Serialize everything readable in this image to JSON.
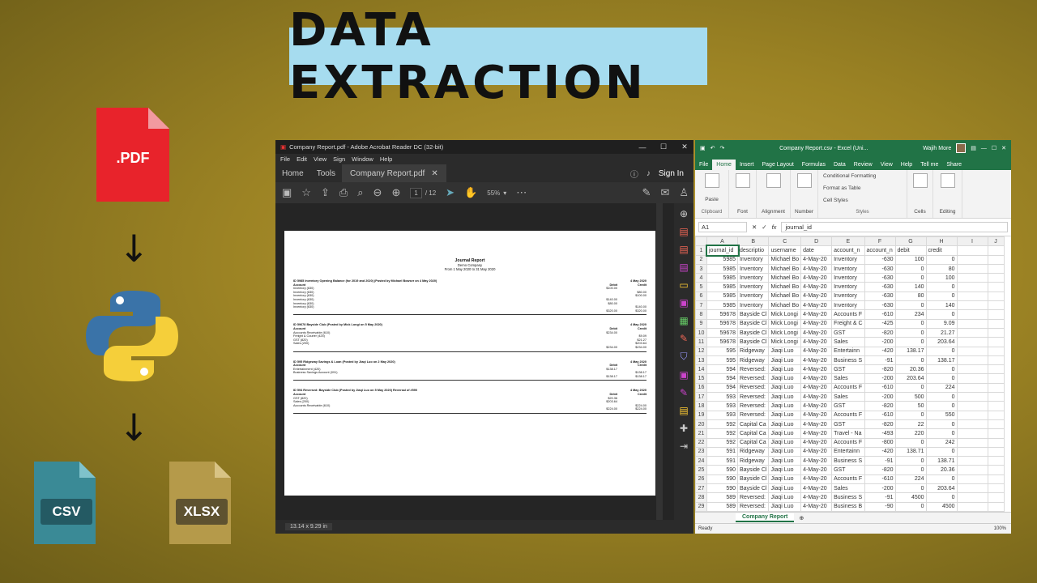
{
  "banner": {
    "title": "DATA EXTRACTION"
  },
  "left_icons": {
    "pdf_label": ".PDF",
    "csv_label": "CSV",
    "xlsx_label": "XLSX",
    "arrow": "↓"
  },
  "acrobat": {
    "title": "Company Report.pdf - Adobe Acrobat Reader DC (32-bit)",
    "menu": [
      "File",
      "Edit",
      "View",
      "Sign",
      "Window",
      "Help"
    ],
    "tabs": {
      "home": "Home",
      "tools": "Tools",
      "doc": "Company Report.pdf"
    },
    "sign_in": "Sign In",
    "page_current": "1",
    "page_total": "/ 12",
    "zoom": "55%",
    "page_size": "13.14 x 9.29 in",
    "report": {
      "title": "Journal Report",
      "company": "Demo Company",
      "period": "From 1 May 2020 to 31 May 2020",
      "entries": [
        {
          "header": "ID 5985 Inventory Opening Balance (for 2019 and 2020) (Posted by Michael Bowser on 4 May 2020)",
          "date": "4 May 2020",
          "rows": [
            [
              "Account",
              "Debit",
              "Credit"
            ],
            [
              "Inventory (630)",
              "$100.00",
              ""
            ],
            [
              "Inventory (630)",
              "",
              "$80.00"
            ],
            [
              "Inventory (630)",
              "",
              "$100.00"
            ],
            [
              "Inventory (630)",
              "$140.00",
              ""
            ],
            [
              "Inventory (630)",
              "$80.00",
              ""
            ],
            [
              "Inventory (630)",
              "",
              "$140.00"
            ],
            [
              "",
              "$320.00",
              "$320.00"
            ]
          ]
        },
        {
          "header": "ID 59678 Bayside Club (Posted by Mick Longi on 5 May 2020)",
          "date": "4 May 2020",
          "rows": [
            [
              "Account",
              "Debit",
              "Credit"
            ],
            [
              "Accounts Receivable (610)",
              "$234.00",
              ""
            ],
            [
              "Freight & Courier (425)",
              "",
              "$9.09"
            ],
            [
              "GST (820)",
              "",
              "$21.27"
            ],
            [
              "Sales (200)",
              "",
              "$203.64"
            ],
            [
              "",
              "$234.00",
              "$234.00"
            ]
          ]
        },
        {
          "header": "ID 595 Ridgeway Savings & Loan (Posted by Jiaqi Luo on 2 May 2020)",
          "date": "4 May 2020",
          "rows": [
            [
              "Account",
              "Debit",
              "Credit"
            ],
            [
              "Entertainment (420)",
              "$138.17",
              ""
            ],
            [
              "Business Savings Account (091)",
              "",
              "$138.17"
            ],
            [
              "",
              "$138.17",
              "$138.17"
            ]
          ]
        },
        {
          "header": "ID 594 Reversed: Bayside Club (Posted by Jiaqi Luo on 5 May 2020) Reversal of #590",
          "date": "4 May 2020",
          "rows": [
            [
              "Account",
              "Debit",
              "Credit"
            ],
            [
              "GST (820)",
              "$20.36",
              ""
            ],
            [
              "Sales (200)",
              "$203.64",
              ""
            ],
            [
              "Accounts Receivable (610)",
              "",
              "$224.00"
            ],
            [
              "",
              "$224.00",
              "$224.00"
            ]
          ]
        }
      ]
    }
  },
  "excel": {
    "title": "Company Report.csv - Excel (Uni...",
    "user": "Wajih More",
    "tabs": [
      "File",
      "Home",
      "Insert",
      "Page Layout",
      "Formulas",
      "Data",
      "Review",
      "View",
      "Help",
      "Tell me",
      "Share"
    ],
    "ribbon": {
      "clipboard": "Clipboard",
      "paste": "Paste",
      "font": "Font",
      "alignment": "Alignment",
      "number": "Number",
      "conditional": "Conditional Formatting",
      "format_table": "Format as Table",
      "cell_styles": "Cell Styles",
      "styles": "Styles",
      "cells": "Cells",
      "editing": "Editing"
    },
    "name_box": "A1",
    "formula": "journal_id",
    "columns": [
      "A",
      "B",
      "C",
      "D",
      "E",
      "F",
      "G",
      "H",
      "I",
      "J"
    ],
    "rows": [
      [
        "journal_id",
        "descriptio",
        "username",
        "date",
        "account_n",
        "account_n",
        "debit",
        "credit"
      ],
      [
        "5985",
        "Inventory",
        "Michael Bo",
        "4-May-20",
        "Inventory",
        "-630",
        "100",
        "0"
      ],
      [
        "5985",
        "Inventory",
        "Michael Bo",
        "4-May-20",
        "Inventory",
        "-630",
        "0",
        "80"
      ],
      [
        "5985",
        "Inventory",
        "Michael Bo",
        "4-May-20",
        "Inventory",
        "-630",
        "0",
        "100"
      ],
      [
        "5985",
        "Inventory",
        "Michael Bo",
        "4-May-20",
        "Inventory",
        "-630",
        "140",
        "0"
      ],
      [
        "5985",
        "Inventory",
        "Michael Bo",
        "4-May-20",
        "Inventory",
        "-630",
        "80",
        "0"
      ],
      [
        "5985",
        "Inventory",
        "Michael Bo",
        "4-May-20",
        "Inventory",
        "-630",
        "0",
        "140"
      ],
      [
        "59678",
        "Bayside Cl",
        "Mick Longi",
        "4-May-20",
        "Accounts F",
        "-610",
        "234",
        "0"
      ],
      [
        "59678",
        "Bayside Cl",
        "Mick Longi",
        "4-May-20",
        "Freight & C",
        "-425",
        "0",
        "9.09"
      ],
      [
        "59678",
        "Bayside Cl",
        "Mick Longi",
        "4-May-20",
        "GST",
        "-820",
        "0",
        "21.27"
      ],
      [
        "59678",
        "Bayside Cl",
        "Mick Longi",
        "4-May-20",
        "Sales",
        "-200",
        "0",
        "203.64"
      ],
      [
        "595",
        "Ridgeway",
        "Jiaqi Luo",
        "4-May-20",
        "Entertainn",
        "-420",
        "138.17",
        "0"
      ],
      [
        "595",
        "Ridgeway",
        "Jiaqi Luo",
        "4-May-20",
        "Business S",
        "-91",
        "0",
        "138.17"
      ],
      [
        "594",
        "Reversed:",
        "Jiaqi Luo",
        "4-May-20",
        "GST",
        "-820",
        "20.36",
        "0"
      ],
      [
        "594",
        "Reversed:",
        "Jiaqi Luo",
        "4-May-20",
        "Sales",
        "-200",
        "203.64",
        "0"
      ],
      [
        "594",
        "Reversed:",
        "Jiaqi Luo",
        "4-May-20",
        "Accounts F",
        "-610",
        "0",
        "224"
      ],
      [
        "593",
        "Reversed:",
        "Jiaqi Luo",
        "4-May-20",
        "Sales",
        "-200",
        "500",
        "0"
      ],
      [
        "593",
        "Reversed:",
        "Jiaqi Luo",
        "4-May-20",
        "GST",
        "-820",
        "50",
        "0"
      ],
      [
        "593",
        "Reversed:",
        "Jiaqi Luo",
        "4-May-20",
        "Accounts F",
        "-610",
        "0",
        "550"
      ],
      [
        "592",
        "Capital Ca",
        "Jiaqi Luo",
        "4-May-20",
        "GST",
        "-820",
        "22",
        "0"
      ],
      [
        "592",
        "Capital Ca",
        "Jiaqi Luo",
        "4-May-20",
        "Travel - Na",
        "-493",
        "220",
        "0"
      ],
      [
        "592",
        "Capital Ca",
        "Jiaqi Luo",
        "4-May-20",
        "Accounts F",
        "-800",
        "0",
        "242"
      ],
      [
        "591",
        "Ridgeway",
        "Jiaqi Luo",
        "4-May-20",
        "Entertainn",
        "-420",
        "138.71",
        "0"
      ],
      [
        "591",
        "Ridgeway",
        "Jiaqi Luo",
        "4-May-20",
        "Business S",
        "-91",
        "0",
        "138.71"
      ],
      [
        "590",
        "Bayside Cl",
        "Jiaqi Luo",
        "4-May-20",
        "GST",
        "-820",
        "0",
        "20.36"
      ],
      [
        "590",
        "Bayside Cl",
        "Jiaqi Luo",
        "4-May-20",
        "Accounts F",
        "-610",
        "224",
        "0"
      ],
      [
        "590",
        "Bayside Cl",
        "Jiaqi Luo",
        "4-May-20",
        "Sales",
        "-200",
        "0",
        "203.64"
      ],
      [
        "589",
        "Reversed:",
        "Jiaqi Luo",
        "4-May-20",
        "Business S",
        "-91",
        "4500",
        "0"
      ],
      [
        "589",
        "Reversed:",
        "Jiaqi Luo",
        "4-May-20",
        "Business B",
        "-90",
        "0",
        "4500"
      ]
    ],
    "sheet_tab": "Company Report",
    "status": "Ready",
    "zoom": "100%"
  }
}
